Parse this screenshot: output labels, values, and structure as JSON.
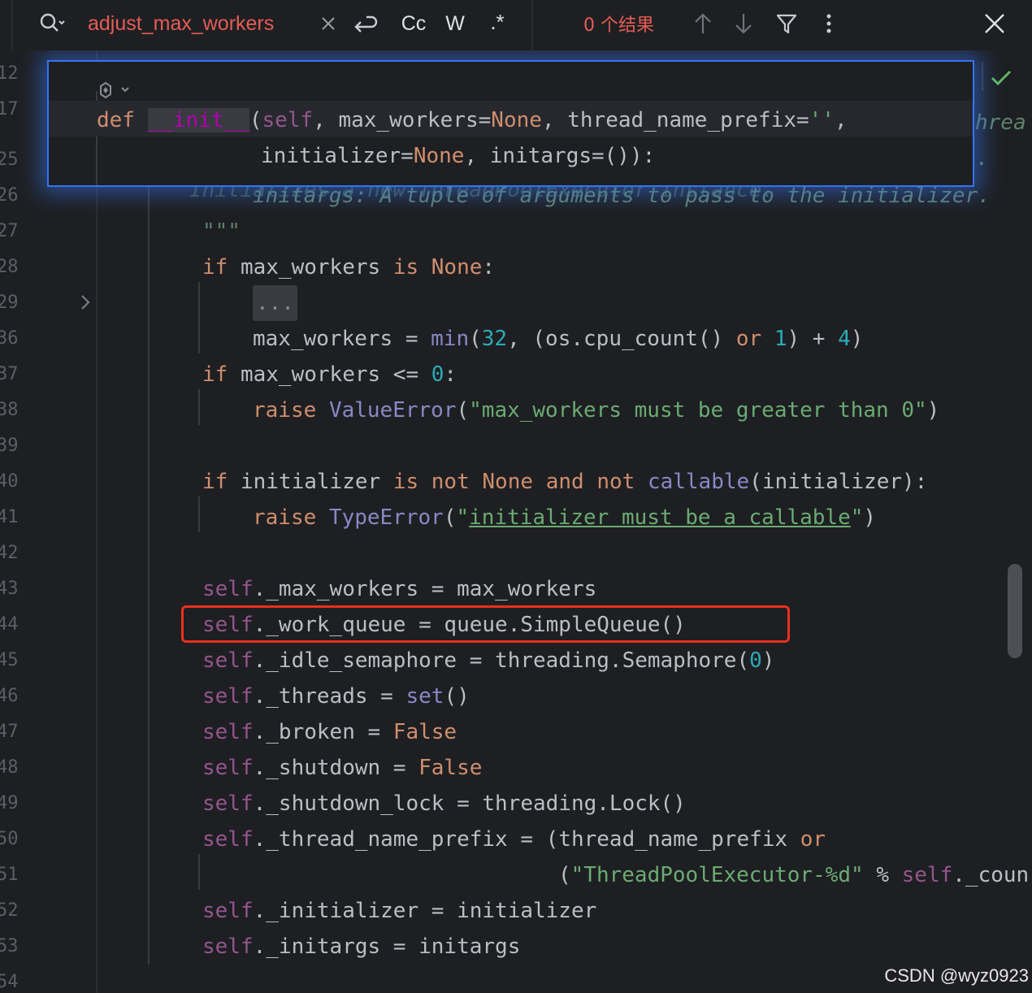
{
  "search": {
    "query": "adjust_max_workers",
    "results_count": "0 个结果",
    "icons": [
      "search-history-icon",
      "clear-icon",
      "new-line-icon",
      "match-case-icon",
      "words-icon",
      "regex-icon",
      "prev-occurrence-icon",
      "next-occurrence-icon",
      "filter-icon",
      "more-options-icon",
      "close-icon"
    ],
    "option_labels": {
      "match_case": "Cc",
      "words": "W",
      "regex": ".*"
    }
  },
  "gutter": {
    "line_numbers": [
      "12",
      "17",
      "25",
      "26",
      "27",
      "28",
      "29",
      "36",
      "37",
      "38",
      "39",
      "40",
      "41",
      "42",
      "43",
      "44",
      "45",
      "46",
      "47",
      "48",
      "49",
      "50",
      "51",
      "52",
      "53",
      "54"
    ]
  },
  "sticky": {
    "line1": {
      "def": "def",
      "name": "__init__",
      "p1": "(",
      "self": "self",
      "p2": ", max_workers=",
      "none1": "None",
      "p3": ", thread_name_prefix=",
      "str": "''",
      "p4": ","
    },
    "line2": {
      "p1": "initializer=",
      "none": "None",
      "p2": ", initargs=()):"
    }
  },
  "code": {
    "l26_doc": "initargs: A tuple of arguments to pass to the initializer.",
    "l26_behind": "\"\"\"Initializes a new ThreadPoolExecutor instance.",
    "l27_doc": "\"\"\"",
    "l28": {
      "if": "if",
      "a": " max_workers ",
      "is": "is",
      "sp": " ",
      "none": "None",
      "b": ":"
    },
    "l29_fold": "...",
    "l36": {
      "a": "max_workers = ",
      "min": "min",
      "b": "(",
      "n32": "32",
      "c": ", (os.cpu_count() ",
      "or": "or",
      "sp": " ",
      "n1": "1",
      "d": ") + ",
      "n4": "4",
      "e": ")"
    },
    "l37": {
      "if": "if",
      "a": " max_workers <= ",
      "n0": "0",
      "b": ":"
    },
    "l38": {
      "raise": "raise",
      "sp": " ",
      "err": "ValueError",
      "a": "(",
      "str": "\"max_workers must be greater than 0\"",
      "b": ")"
    },
    "l40": {
      "if": "if",
      "a": " initializer ",
      "is": "is",
      "sp1": " ",
      "not1": "not",
      "sp2": " ",
      "none": "None",
      "sp3": " ",
      "and": "and",
      "sp4": " ",
      "not2": "not",
      "sp5": " ",
      "callable": "callable",
      "b": "(initializer):"
    },
    "l41": {
      "raise": "raise",
      "sp": " ",
      "err": "TypeError",
      "a": "(",
      "q1": "\"",
      "str": "initializer must be a callable",
      "q2": "\"",
      "b": ")"
    },
    "l43": {
      "self": "self",
      "a": "._max_workers = max_workers"
    },
    "l44": {
      "self": "self",
      "a": "._work_queue = queue.SimpleQueue()"
    },
    "l45": {
      "self": "self",
      "a": "._idle_semaphore = threading.Semaphore(",
      "n0": "0",
      "b": ")"
    },
    "l46": {
      "self": "self",
      "a": "._threads = ",
      "set": "set",
      "b": "()"
    },
    "l47": {
      "self": "self",
      "a": "._broken = ",
      "false": "False"
    },
    "l48": {
      "self": "self",
      "a": "._shutdown = ",
      "false": "False"
    },
    "l49": {
      "self": "self",
      "a": "._shutdown_lock = threading.Lock()"
    },
    "l50": {
      "self": "self",
      "a": "._thread_name_prefix = (thread_name_prefix ",
      "or": "or"
    },
    "l51": {
      "a": "(",
      "str": "\"ThreadPoolExecutor-%d\"",
      "b": " % ",
      "self": "self",
      "c": "._coun"
    },
    "l52": {
      "self": "self",
      "a": "._initializer = initializer"
    },
    "l53": {
      "self": "self",
      "a": "._initargs = initargs"
    }
  },
  "right_edge_fragments": [
    "hrea",
    "."
  ],
  "watermark": "CSDN @wyz0923",
  "colors": {
    "search_text": "#e55c55",
    "highlight_box": "#e8301f",
    "popup_border": "#3574f0",
    "inspection_ok": "#5fb865"
  }
}
